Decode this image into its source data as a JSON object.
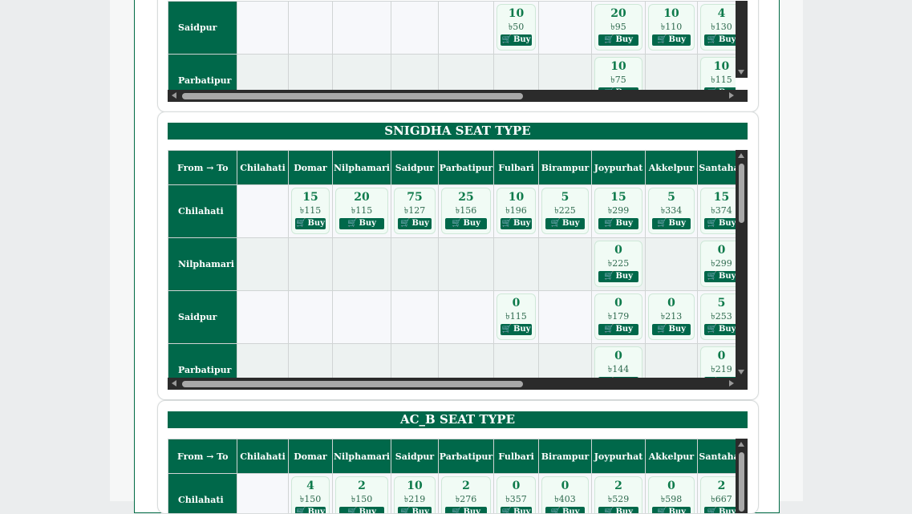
{
  "colors": {
    "brand": "#00684a",
    "fare_bg": "#f1fbf5",
    "seat_text": "#0e7a4b"
  },
  "buy_label": "Buy",
  "currency": "৳",
  "columns": [
    "From → To",
    "Chilahati",
    "Domar",
    "Nilphamari",
    "Saidpur",
    "Parbatipur",
    "Fulbari",
    "Birampur",
    "Joypurhat",
    "Akkelpur",
    "Santahar"
  ],
  "sections": [
    {
      "title": "",
      "rows": [
        {
          "from": "Saidpur",
          "cells": [
            null,
            null,
            null,
            null,
            null,
            {
              "seats": "10",
              "price": "৳50"
            },
            null,
            {
              "seats": "20",
              "price": "৳95"
            },
            {
              "seats": "10",
              "price": "৳110"
            },
            {
              "seats": "4",
              "price": "৳130"
            }
          ]
        },
        {
          "from": "Parbatipur",
          "cells": [
            null,
            null,
            null,
            null,
            null,
            null,
            null,
            {
              "seats": "10",
              "price": "৳75"
            },
            null,
            {
              "seats": "10",
              "price": "৳115"
            }
          ]
        }
      ]
    },
    {
      "title": "SNIGDHA SEAT TYPE",
      "rows": [
        {
          "from": "Chilahati",
          "cells": [
            null,
            {
              "seats": "15",
              "price": "৳115"
            },
            {
              "seats": "20",
              "price": "৳115"
            },
            {
              "seats": "75",
              "price": "৳127"
            },
            {
              "seats": "25",
              "price": "৳156"
            },
            {
              "seats": "10",
              "price": "৳196"
            },
            {
              "seats": "5",
              "price": "৳225"
            },
            {
              "seats": "15",
              "price": "৳299"
            },
            {
              "seats": "5",
              "price": "৳334"
            },
            {
              "seats": "15",
              "price": "৳374"
            }
          ]
        },
        {
          "from": "Nilphamari",
          "cells": [
            null,
            null,
            null,
            null,
            null,
            null,
            null,
            {
              "seats": "0",
              "price": "৳225"
            },
            null,
            {
              "seats": "0",
              "price": "৳299"
            }
          ]
        },
        {
          "from": "Saidpur",
          "cells": [
            null,
            null,
            null,
            null,
            null,
            {
              "seats": "0",
              "price": "৳115"
            },
            null,
            {
              "seats": "0",
              "price": "৳179"
            },
            {
              "seats": "0",
              "price": "৳213"
            },
            {
              "seats": "5",
              "price": "৳253"
            }
          ]
        },
        {
          "from": "Parbatipur",
          "cells": [
            null,
            null,
            null,
            null,
            null,
            null,
            null,
            {
              "seats": "0",
              "price": "৳144"
            },
            null,
            {
              "seats": "0",
              "price": "৳219"
            }
          ]
        }
      ]
    },
    {
      "title": "AC_B SEAT TYPE",
      "rows": [
        {
          "from": "Chilahati",
          "cells": [
            null,
            {
              "seats": "4",
              "price": "৳150"
            },
            {
              "seats": "2",
              "price": "৳150"
            },
            {
              "seats": "10",
              "price": "৳219"
            },
            {
              "seats": "2",
              "price": "৳276"
            },
            {
              "seats": "0",
              "price": "৳357"
            },
            {
              "seats": "0",
              "price": "৳403"
            },
            {
              "seats": "2",
              "price": "৳529"
            },
            {
              "seats": "0",
              "price": "৳598"
            },
            {
              "seats": "2",
              "price": "৳667"
            }
          ]
        }
      ]
    }
  ]
}
